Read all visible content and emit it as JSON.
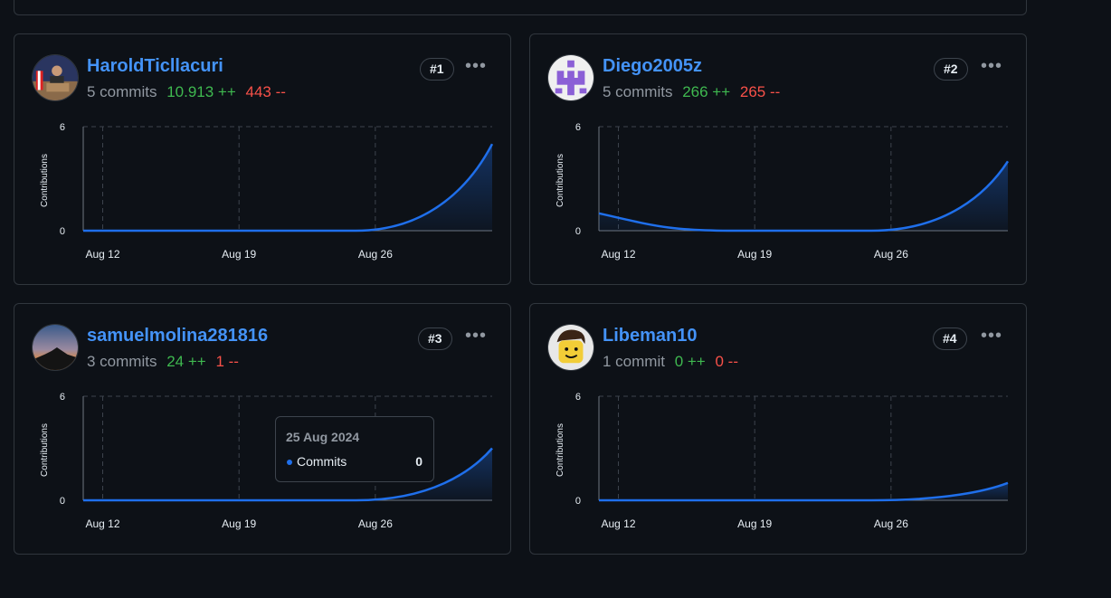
{
  "contributors": [
    {
      "username": "HaroldTicllacuri",
      "commits": "5 commits",
      "additions": "10.913 ++",
      "deletions": "443 --",
      "rank": "#1",
      "avatar": "photo-podium-avatar",
      "chart_data": {
        "type": "area",
        "ylabel": "Contributions",
        "ylim": [
          0,
          6
        ],
        "yticks": [
          "6",
          "0"
        ],
        "xticks": [
          "Aug 12",
          "Aug 19",
          "Aug 26"
        ],
        "series": [
          {
            "x": [
              "Aug 11",
              "Aug 25",
              "Sep 1"
            ],
            "values": [
              0,
              0,
              5
            ]
          }
        ]
      }
    },
    {
      "username": "Diego2005z",
      "commits": "5 commits",
      "additions": "266 ++",
      "deletions": "265 --",
      "rank": "#2",
      "avatar": "purple-identicon-avatar",
      "chart_data": {
        "type": "area",
        "ylabel": "Contributions",
        "ylim": [
          0,
          6
        ],
        "yticks": [
          "6",
          "0"
        ],
        "xticks": [
          "Aug 12",
          "Aug 19",
          "Aug 26"
        ],
        "series": [
          {
            "x": [
              "Aug 11",
              "Aug 18",
              "Aug 25",
              "Sep 1"
            ],
            "values": [
              1,
              0,
              0,
              4
            ]
          }
        ]
      }
    },
    {
      "username": "samuelmolina281816",
      "commits": "3 commits",
      "additions": "24 ++",
      "deletions": "1 --",
      "rank": "#3",
      "avatar": "sunset-landscape-avatar",
      "chart_data": {
        "type": "area",
        "ylabel": "Contributions",
        "ylim": [
          0,
          6
        ],
        "yticks": [
          "6",
          "0"
        ],
        "xticks": [
          "Aug 12",
          "Aug 19",
          "Aug 26"
        ],
        "series": [
          {
            "x": [
              "Aug 11",
              "Aug 25",
              "Sep 1"
            ],
            "values": [
              0,
              0,
              3
            ]
          }
        ]
      },
      "tooltip": {
        "date": "25 Aug 2024",
        "label": "Commits",
        "value": "0"
      }
    },
    {
      "username": "Libeman10",
      "commits": "1 commit",
      "additions": "0 ++",
      "deletions": "0 --",
      "rank": "#4",
      "avatar": "lego-figure-avatar",
      "chart_data": {
        "type": "area",
        "ylabel": "Contributions",
        "ylim": [
          0,
          6
        ],
        "yticks": [
          "6",
          "0"
        ],
        "xticks": [
          "Aug 12",
          "Aug 19",
          "Aug 26"
        ],
        "series": [
          {
            "x": [
              "Aug 11",
              "Aug 25",
              "Sep 1"
            ],
            "values": [
              0,
              0,
              1
            ]
          }
        ]
      }
    }
  ],
  "colors": {
    "line": "#1f6feb",
    "grid": "#3d444d",
    "link": "#4493f8",
    "additions": "#3fb950",
    "deletions": "#f85149"
  }
}
